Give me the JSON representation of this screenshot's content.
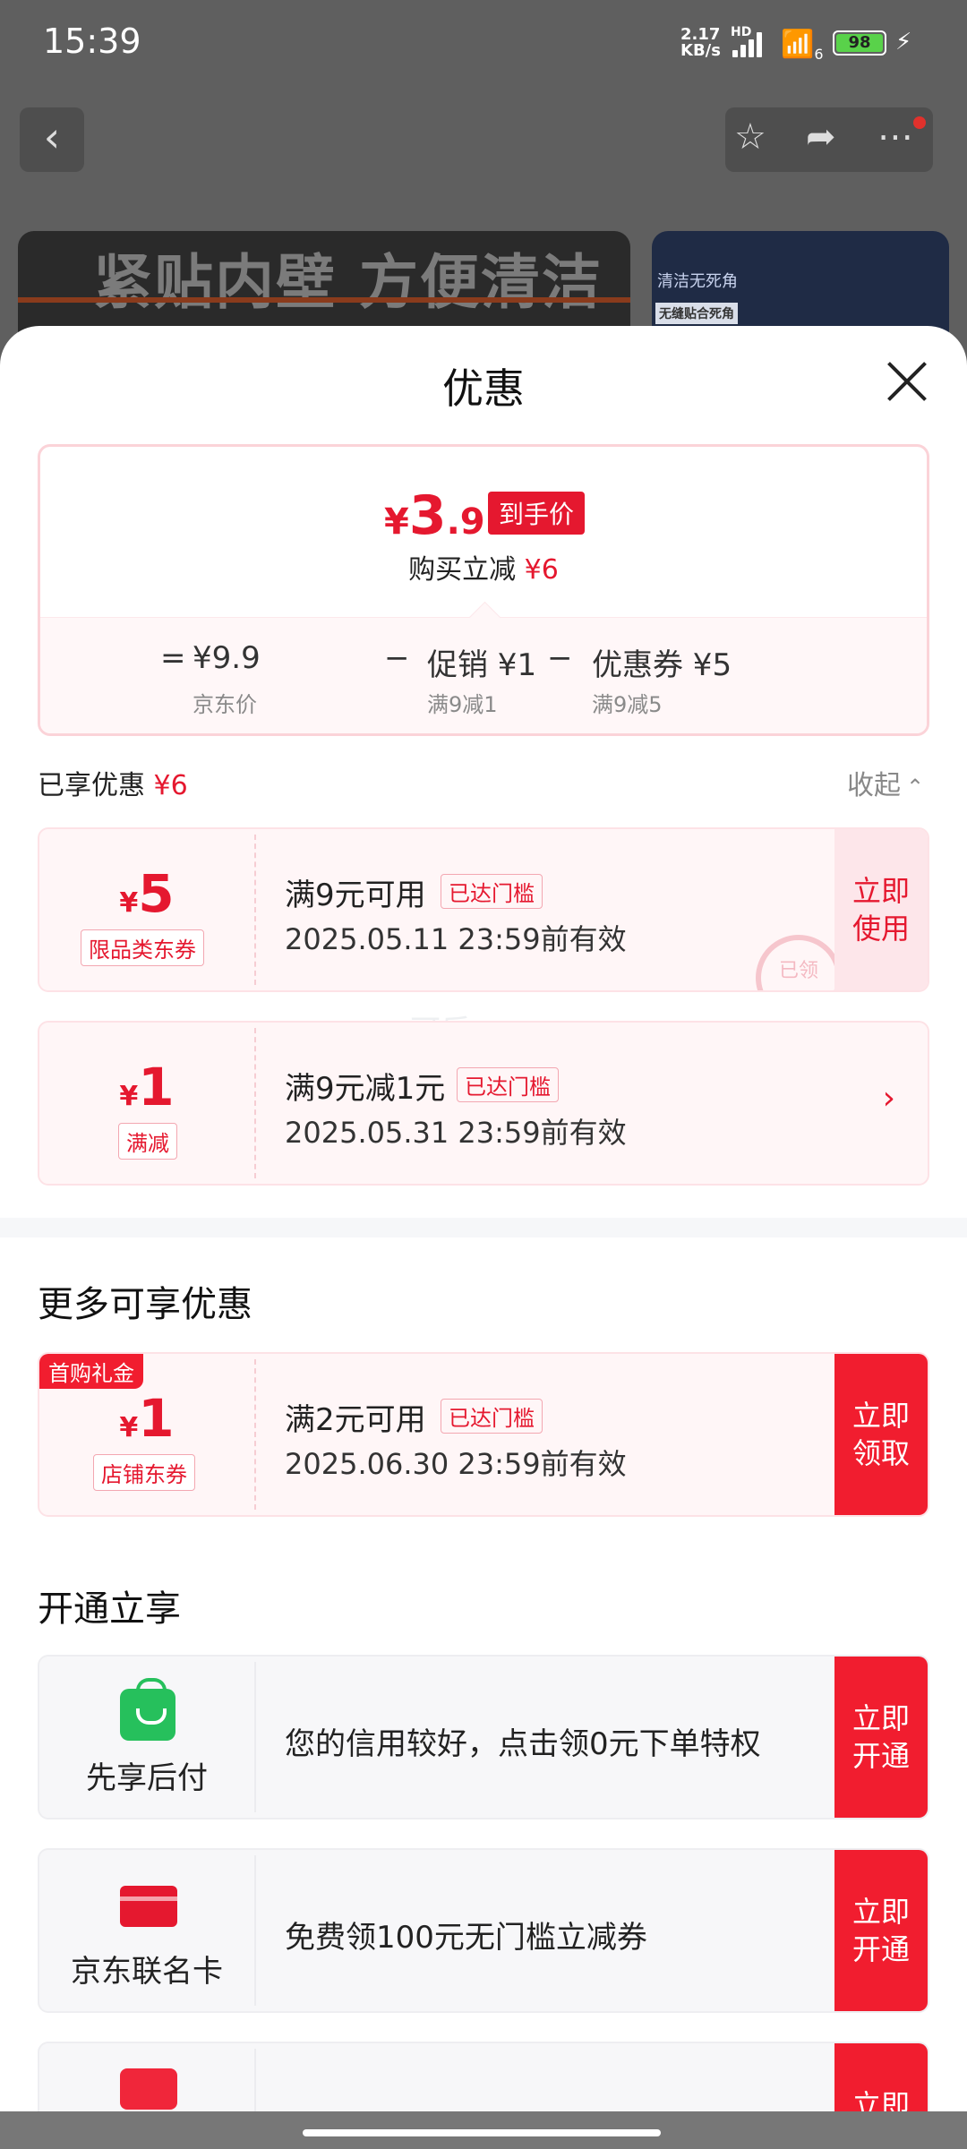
{
  "status": {
    "time": "15:39",
    "net_speed_value": "2.17",
    "net_speed_unit": "KB/s",
    "hd": "HD",
    "wifi": "6",
    "battery": "98"
  },
  "background": {
    "banner_text": "紧贴内壁 方便清洁",
    "banner2_line1": "清洁无死角",
    "banner2_line2": "无缝贴合死角"
  },
  "sheet": {
    "title": "优惠",
    "price": {
      "currency": "¥",
      "integer": "3",
      "decimal": ".9",
      "tag": "到手价"
    },
    "reduce_label": "购买立减",
    "reduce_value": "¥6",
    "formula": {
      "eq": "=",
      "minus": "−",
      "base": "¥9.9",
      "base_sub": "京东价",
      "promo": "促销 ¥1",
      "promo_sub": "满9减1",
      "coupon": "优惠券 ¥5",
      "coupon_sub": "满9减5"
    },
    "enjoyed_label": "已享优惠",
    "enjoyed_value": "¥6",
    "collapse": "收起",
    "watermark": "可乐-",
    "enjoyed_coupons": [
      {
        "currency": "¥",
        "amount": "5",
        "type": "限品类东券",
        "condition": "满9元可用",
        "badge": "已达门槛",
        "valid": "2025.05.11 23:59前有效",
        "button": "立即\n使用",
        "stamp": "已领"
      },
      {
        "currency": "¥",
        "amount": "1",
        "type": "满减",
        "condition": "满9元减1元",
        "badge": "已达门槛",
        "valid": "2025.05.31 23:59前有效"
      }
    ],
    "more_title": "更多可享优惠",
    "more_coupons": [
      {
        "gift": "首购礼金",
        "currency": "¥",
        "amount": "1",
        "type": "店铺东券",
        "condition": "满2元可用",
        "badge": "已达门槛",
        "valid": "2025.06.30 23:59前有效",
        "button": "立即\n领取"
      }
    ],
    "open_title": "开通立享",
    "open_items": [
      {
        "name": "先享后付",
        "desc": "您的信用较好，点击领0元下单特权",
        "button": "立即\n开通",
        "icon": "shopping-bag-icon",
        "icon_color": "#26c05c"
      },
      {
        "name": "京东联名卡",
        "desc": "免费领100元无门槛立减券",
        "button": "立即\n开通",
        "icon": "credit-card-icon",
        "icon_color": "#e5182f"
      },
      {
        "name": "",
        "desc": "",
        "button": "立即",
        "icon": "wallet-icon",
        "icon_color": "#f0263a"
      }
    ]
  },
  "colors": {
    "accent": "#e5182f",
    "button": "#f11d2f",
    "coupon_bg": "#fff6f7"
  }
}
